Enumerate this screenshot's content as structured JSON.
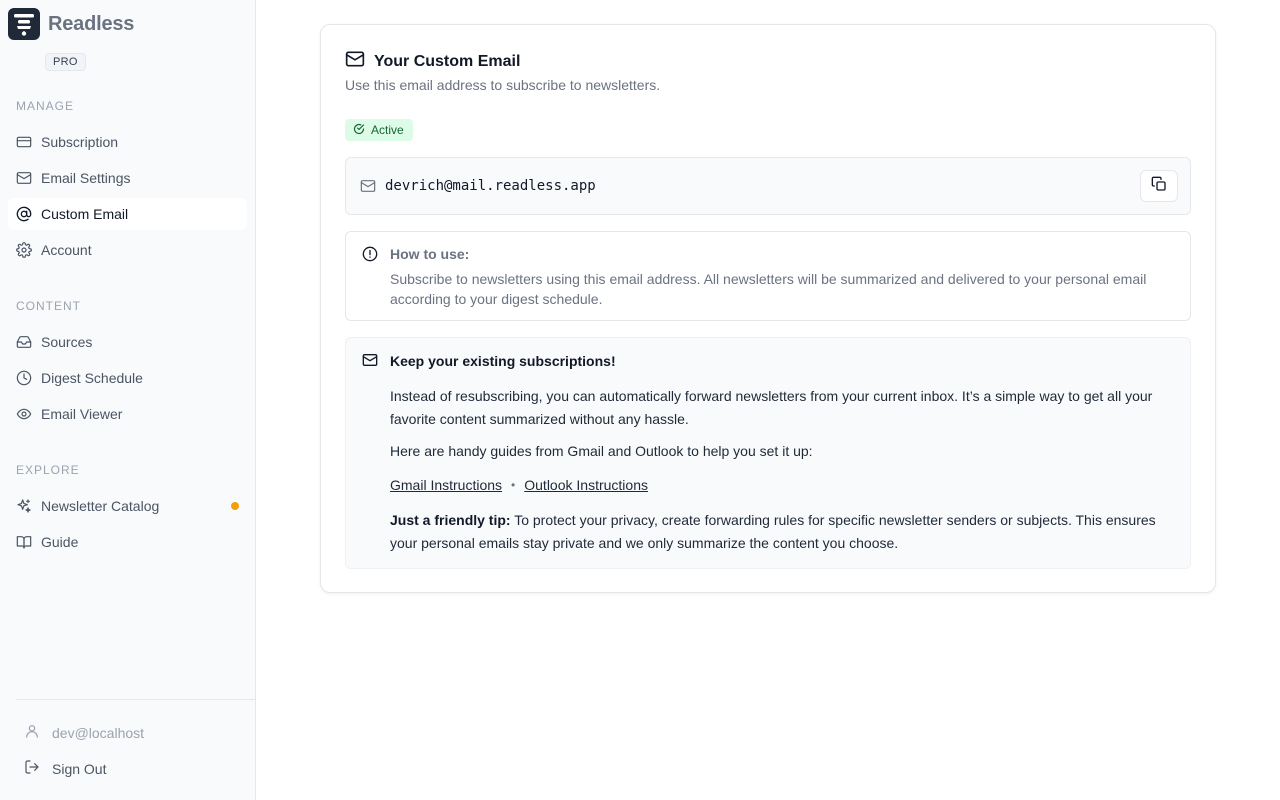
{
  "brand": {
    "name": "Readless",
    "plan_badge": "PRO"
  },
  "sidebar": {
    "sections": [
      {
        "label": "MANAGE"
      },
      {
        "label": "CONTENT"
      },
      {
        "label": "EXPLORE"
      }
    ],
    "manage": [
      {
        "label": "Subscription",
        "icon": "credit-card-icon"
      },
      {
        "label": "Email Settings",
        "icon": "mail-icon"
      },
      {
        "label": "Custom Email",
        "icon": "at-sign-icon",
        "active": true
      },
      {
        "label": "Account",
        "icon": "gear-icon"
      }
    ],
    "content": [
      {
        "label": "Sources",
        "icon": "inbox-icon"
      },
      {
        "label": "Digest Schedule",
        "icon": "clock-icon"
      },
      {
        "label": "Email Viewer",
        "icon": "eye-icon"
      }
    ],
    "explore": [
      {
        "label": "Newsletter Catalog",
        "icon": "sparkles-icon",
        "has_indicator": true
      },
      {
        "label": "Guide",
        "icon": "book-icon"
      }
    ],
    "user_email": "dev@localhost",
    "sign_out_label": "Sign Out"
  },
  "custom_email": {
    "title": "Your Custom Email",
    "subtitle": "Use this email address to subscribe to newsletters.",
    "status": "Active",
    "address": "devrich@mail.readless.app",
    "howto_title": "How to use:",
    "howto_text": "Subscribe to newsletters using this email address. All newsletters will be summarized and delivered to your personal email according to your digest schedule.",
    "keep_title": "Keep your existing subscriptions!",
    "keep_p1": "Instead of resubscribing, you can automatically forward newsletters from your current inbox. It’s a simple way to get all your favorite content summarized without any hassle.",
    "keep_p2": "Here are handy guides from Gmail and Outlook to help you set it up:",
    "gmail_link": "Gmail Instructions",
    "link_separator": "•",
    "outlook_link": "Outlook Instructions",
    "tip_label": "Just a friendly tip:",
    "tip_text": " To protect your privacy, create forwarding rules for specific newsletter senders or subjects. This ensures your personal emails stay private and we only summarize the content you choose."
  },
  "colors": {
    "accent_active_bg": "#dcfce7",
    "accent_active_text": "#166534",
    "indicator": "#f59e0b"
  }
}
